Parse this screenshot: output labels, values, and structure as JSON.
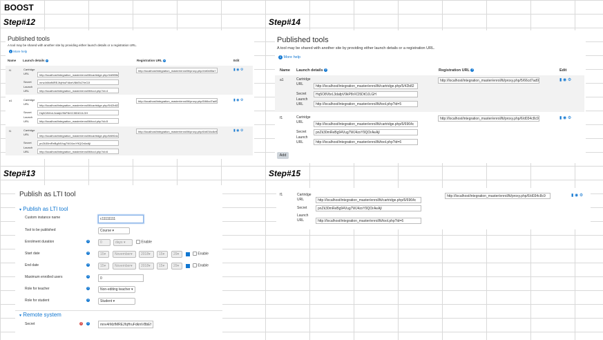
{
  "header": {
    "title": "BOOST"
  },
  "steps": {
    "s12": "Step#12",
    "s13": "Step#13",
    "s14": "Step#14",
    "s15": "Step#15"
  },
  "tools": {
    "title": "Published tools",
    "description": "A tool may be shared with another site by providing either launch details or a registration URL.",
    "more_help": "More help",
    "col_name": "Name",
    "col_launch": "Launch details",
    "col_reg": "Registration URL",
    "col_edit": "Edit",
    "lbl_cartridge": "Cartridge",
    "lbl_url": "URL",
    "lbl_secret": "Secret",
    "lbl_launch": "Launch",
    "add_button": "Add",
    "rows12": [
      {
        "name": "t1",
        "cartridge": "http://localhost/integration_master/enrol/lti/cartridge.php/4/d9f8fe",
        "secret": "mnv4rMzfMREJfqHruFdkmV8bEhZYeOJl",
        "launch": "http://localhost/integration_master/enrol/lti/tool.php?id=4",
        "reg": "http://localhost/integration_master/enrol/lti/proxy.php/4/d0e85a7"
      },
      {
        "name": "a1",
        "cartridge": "http://localhost/integration_master/enrol/lti/cartridge.php/5/42b82",
        "secret": "Hq5O8VbrL3dafpV9kP8rXCl5DtOJLGH",
        "launch": "http://localhost/integration_master/enrol/lti/tool.php?id=5",
        "reg": "http://localhost/integration_master/enrol/lti/proxy.php/5/66cd7ad9"
      },
      {
        "name": "f1",
        "cartridge": "http://localhost/integration_master/enrol/lti/cartridge.php/6/6964c",
        "secret": "pnZk30mReBg94Vug7WJ4zxY9QOrAeAjl",
        "launch": "http://localhost/integration_master/enrol/lti/tool.php?id=6",
        "reg": "http://localhost/integration_master/enrol/lti/proxy.php/6/d034c8c9"
      }
    ],
    "rows14": [
      {
        "name": "a1",
        "cartridge": "http://localhost/integration_master/enrol/lti/cartridge.php/5/42b82",
        "secret": "Hq5O8VbrL3dafpV9kP8rXCl5DtOJLGH",
        "launch": "http://localhost/integration_master/enrol/lti/tool.php?id=5",
        "reg": "http://localhost/integration_master/enrol/lti/proxy.php/5/66cd7ad9"
      },
      {
        "name": "f1",
        "cartridge": "http://localhost/integration_master/enrol/lti/cartridge.php/6/6964c",
        "secret": "pnZk30mReBg94Vug7WJ4zxY9QOrAeAjl",
        "launch": "http://localhost/integration_master/enrol/lti/tool.php?id=6",
        "reg": "http://localhost/integration_master/enrol/lti/proxy.php/6/d034c8c9"
      }
    ],
    "row15": {
      "name": "f1",
      "cartridge": "http://localhost/integration_master/enrol/lti/cartridge.php/6/6964c",
      "secret": "pnZk30mReBg94Vug7WJ4zxY9QOrAeAjl",
      "launch": "http://localhost/integration_master/enrol/lti/tool.php?id=6",
      "reg": "http://localhost/integration_master/enrol/lti/proxy.php/6/d034c8c9"
    }
  },
  "form": {
    "page_title": "Publish as LTI tool",
    "section1": "Publish as LTI tool",
    "section2": "Remote system",
    "custom_name_label": "Custom instance name",
    "custom_name_value": "c11111111",
    "tool_label": "Tool to be published",
    "tool_value": "Course",
    "duration_label": "Enrolment duration",
    "duration_value": "0",
    "duration_unit": "days",
    "enable": "Enable",
    "start_label": "Start date",
    "end_label": "End date",
    "date_day": "15",
    "date_month": "November",
    "date_year": "2018",
    "date_hour": "15",
    "date_min": "29",
    "max_label": "Maximum enrolled users",
    "max_value": "0",
    "teacher_label": "Role for teacher",
    "teacher_value": "Non-editing teacher",
    "student_label": "Role for student",
    "student_value": "Student",
    "secret_label": "Secret",
    "secret_value": "mnv4rMzfMREJfqHruFdkmV8bEf"
  },
  "colors": {
    "accent": "#1177d1",
    "row_alt": "#f2f2f2"
  }
}
